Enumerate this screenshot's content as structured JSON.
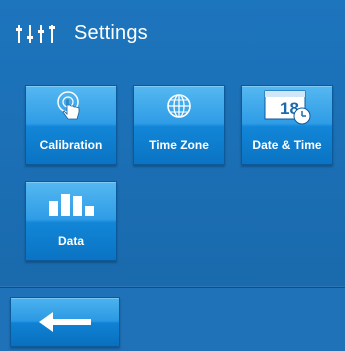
{
  "header": {
    "title": "Settings",
    "icon": "sliders-icon"
  },
  "tiles": [
    {
      "label": "Calibration",
      "icon": "touch-target-icon"
    },
    {
      "label": "Time Zone",
      "icon": "globe-icon"
    },
    {
      "label": "Date & Time",
      "icon": "calendar-clock-icon",
      "calendar_day": "18"
    },
    {
      "label": "Data",
      "icon": "bar-chart-icon"
    }
  ],
  "back_button": {
    "icon": "arrow-left-icon"
  },
  "colors": {
    "background": "#1f72b8",
    "tile_top": "#55b8f1",
    "tile_bottom": "#0b73c3",
    "text": "#ffffff"
  }
}
